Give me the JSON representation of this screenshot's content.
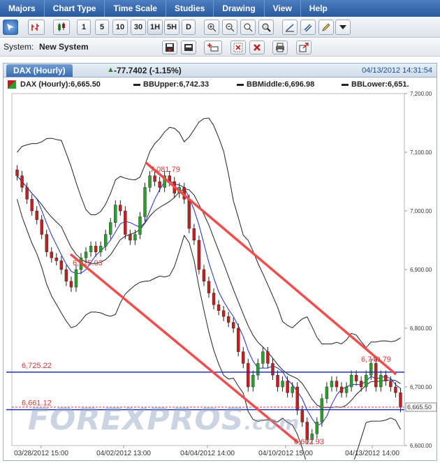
{
  "menu": [
    "Majors",
    "Chart Type",
    "Time Scale",
    "Studies",
    "Drawing",
    "View",
    "Help"
  ],
  "toolbar": {
    "periods": [
      "1",
      "5",
      "10",
      "30",
      "1H",
      "5H",
      "D"
    ],
    "selected": "1H"
  },
  "system": {
    "label": "System:",
    "value": "New System"
  },
  "panel": {
    "tab": "DAX (Hourly)",
    "change": "-77.7402 (-1.15%)",
    "datetime": "04/13/2012 14:31:54"
  },
  "legend": {
    "main": "DAX (Hourly):6,665.50",
    "upper": "BBUpper:6,742.33",
    "middle": "BBMiddle:6,696.98",
    "lower": "BBLower:6,651."
  },
  "colors": {
    "up": "#2aa02a",
    "down": "#c0201e",
    "channel": "#ef4e4e",
    "hline": "#2430b8",
    "ma": "#1d2fd4"
  },
  "watermark": "FOREXPROS",
  "watermark_suffix": ".com",
  "chart_data": {
    "type": "line",
    "title": "DAX (Hourly)",
    "ylim": [
      6600,
      7200
    ],
    "yticks": [
      "7,200.00",
      "7,100.00",
      "7,000.00",
      "6,900.00",
      "6,800.00",
      "6,700.00",
      "6,600.00"
    ],
    "xticks": [
      "03/28/2012 15:00",
      "04/02/2012 13:00",
      "04/04/2012 14:00",
      "04/10/2012 15:00",
      "04/13/2012 14:00"
    ],
    "last_price": "6,665.50",
    "annotations": [
      "7,081.79",
      "6,925.03",
      "6,740.79",
      "6,602.93"
    ],
    "hlines": [
      {
        "label": "6,725.22",
        "value": 6725.22
      },
      {
        "label": "6,661.12",
        "value": 6661.12
      }
    ],
    "close": [
      7060,
      7040,
      7020,
      7000,
      6985,
      6960,
      6930,
      6920,
      6915,
      6900,
      6880,
      6870,
      6900,
      6920,
      6930,
      6940,
      6930,
      6940,
      6960,
      6980,
      7010,
      7000,
      6960,
      6950,
      6960,
      6990,
      7040,
      7060,
      7050,
      7040,
      7060,
      7050,
      7030,
      7040,
      7020,
      6970,
      6950,
      6900,
      6880,
      6860,
      6840,
      6830,
      6820,
      6810,
      6800,
      6760,
      6740,
      6700,
      6720,
      6740,
      6760,
      6740,
      6720,
      6700,
      6710,
      6690,
      6700,
      6660,
      6640,
      6610,
      6620,
      6640,
      6680,
      6700,
      6710,
      6700,
      6690,
      6700,
      6720,
      6710,
      6700,
      6720,
      6740,
      6700,
      6720,
      6710,
      6700,
      6690,
      6665
    ]
  }
}
